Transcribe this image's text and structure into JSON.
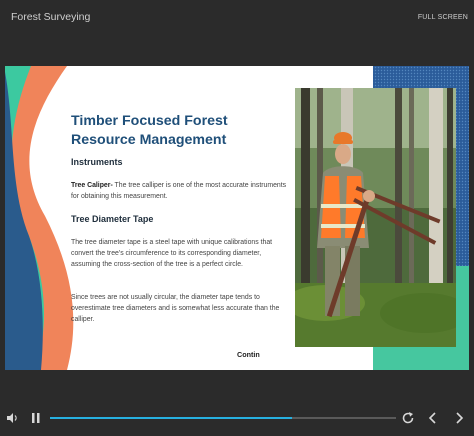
{
  "app": {
    "title": "Forest Surveying",
    "fullscreen_label": "FULL SCREEN"
  },
  "slide": {
    "title": "Timber Focused Forest Resource Management",
    "subheading_instruments": "Instruments",
    "caliper_term": "Tree Caliper-",
    "caliper_text": " The tree calliper is one of the most accurate instruments for obtaining this measurement.",
    "subheading_tape": "Tree Diameter Tape",
    "tape_paragraph_1": "The tree diameter tape is a steel tape with unique calibrations that convert the tree's circumference to its corresponding diameter, assuming the cross-section of the tree is a perfect circle.",
    "tape_paragraph_2": "Since trees are not usually circular, the diameter tape tends to overestimate tree diameters and is somewhat less accurate than the calliper.",
    "continue_label": "Contin"
  },
  "player": {
    "progress": 0.7
  },
  "colors": {
    "accent_orange": "#f0845a",
    "accent_blue": "#2a5b8c",
    "accent_teal": "#3cc9a0",
    "progress": "#27b0e0"
  },
  "icons": [
    "volume-icon",
    "pause-icon",
    "replay-icon",
    "previous-icon",
    "next-icon"
  ]
}
